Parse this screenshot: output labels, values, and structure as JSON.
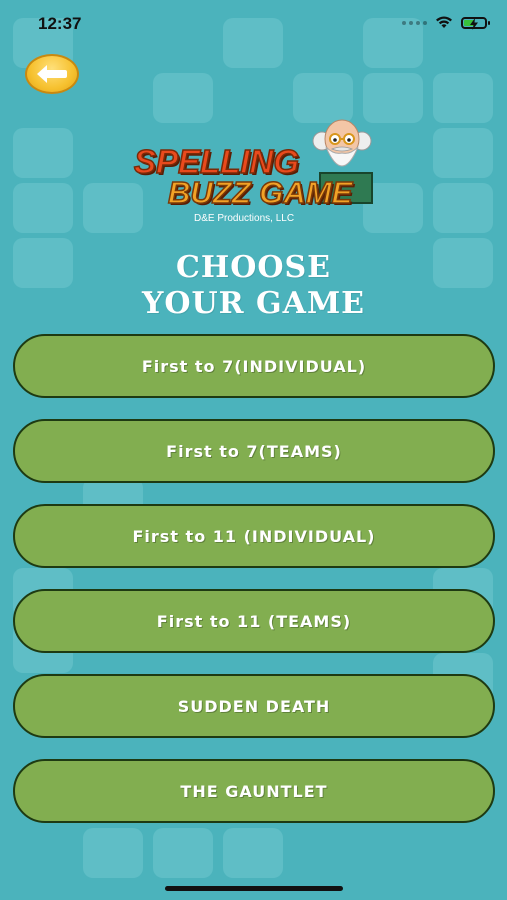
{
  "status_bar": {
    "time": "12:37"
  },
  "header": {
    "back_icon": "back-arrow-icon"
  },
  "logo": {
    "line1": "SPELLING",
    "line2": "BUZZ GAME",
    "company": "D&E Productions, LLC"
  },
  "heading": {
    "line1": "CHOOSE",
    "line2": "YOUR GAME"
  },
  "games": [
    {
      "label": "First to 7(INDIVIDUAL)"
    },
    {
      "label": "First to 7(TEAMS)"
    },
    {
      "label": "First to 11 (INDIVIDUAL)"
    },
    {
      "label": "First to 11 (TEAMS)"
    },
    {
      "label": "SUDDEN DEATH"
    },
    {
      "label": "THE GAUNTLET"
    }
  ],
  "colors": {
    "background": "#4bb3bc",
    "button_fill": "#82ae50",
    "button_border": "#1e3a12",
    "back_button": "#f6c12f"
  }
}
